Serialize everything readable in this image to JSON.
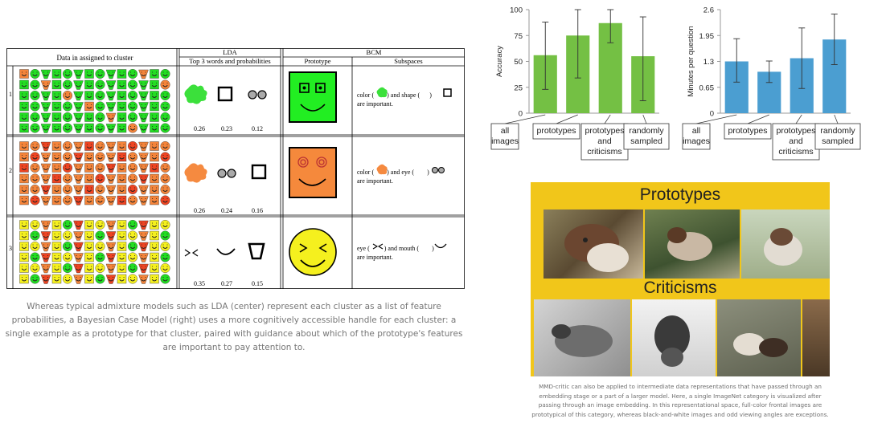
{
  "table": {
    "header_cluster": "Data in assigned to cluster",
    "header_lda": "LDA",
    "header_lda_sub": "Top 3 words and probabilities",
    "header_bcm": "BCM",
    "header_prototype": "Prototype",
    "header_subspaces": "Subspaces",
    "rows": [
      {
        "num": "1",
        "probs": [
          "0.26",
          "0.23",
          "0.12"
        ],
        "sub_line1_a": "color (",
        "sub_line1_b": ") and shape (",
        "sub_line1_c": ")",
        "sub_line2": "are important."
      },
      {
        "num": "2",
        "probs": [
          "0.26",
          "0.24",
          "0.16"
        ],
        "sub_line1_a": "color (",
        "sub_line1_b": ") and eye (",
        "sub_line1_c": ")",
        "sub_line2": "are important."
      },
      {
        "num": "3",
        "probs": [
          "0.35",
          "0.27",
          "0.15"
        ],
        "sub_line1_a": "eye (",
        "sub_line1_b": ") and mouth (",
        "sub_line1_c": ")",
        "sub_line2": "are important."
      }
    ],
    "colors": {
      "green": "#22dd22",
      "orange": "#f4843a",
      "yellow": "#f5f01e",
      "red": "#ee4422"
    }
  },
  "left_caption": "Whereas typical admixture models such as LDA (center) represent each cluster as a list of feature probabilities, a Bayesian Case Model (right) uses a more cognitively accessible handle for each cluster: a single example as a prototype for that cluster, paired with guidance about which of the prototype's features are important to pay attention to.",
  "chart_data": [
    {
      "type": "bar",
      "categories": [
        "all\nimages",
        "prototypes",
        "prototypes\nand\ncriticisms",
        "randomly\nsampled"
      ],
      "values": [
        56,
        75,
        87,
        55
      ],
      "error": [
        [
          23,
          88
        ],
        [
          34,
          100
        ],
        [
          68,
          100
        ],
        [
          12,
          93
        ]
      ],
      "ylabel": "Accuracy",
      "ylim": [
        0,
        100
      ],
      "yticks": [
        "0",
        "25",
        "50",
        "75",
        "100"
      ],
      "color": "#74c044"
    },
    {
      "type": "bar",
      "categories": [
        "all\nimages",
        "prototypes",
        "prototypes\nand\ncriticisms",
        "randomly\nsampled"
      ],
      "values": [
        1.3,
        1.04,
        1.38,
        1.85
      ],
      "error": [
        [
          0.78,
          1.87
        ],
        [
          0.77,
          1.31
        ],
        [
          0.62,
          2.14
        ],
        [
          1.22,
          2.49
        ]
      ],
      "ylabel": "Minutes per question",
      "ylim": [
        0,
        2.6
      ],
      "yticks": [
        "0",
        "0.65",
        "1.3",
        "1.95",
        "2.6"
      ],
      "color": "#4b9ed1"
    }
  ],
  "panel": {
    "title_top": "Prototypes",
    "title_bottom": "Criticisms",
    "bg": "#f1c61a"
  },
  "right_caption": "MMD-critic can also be applied to intermediate data representations that have passed through an embedding stage or a part of a larger model. Here, a single ImageNet category is visualized after passing through an image embedding. In this representational space, full-color frontal images are prototypical of this category, whereas black-and-white images and odd viewing angles are exceptions."
}
